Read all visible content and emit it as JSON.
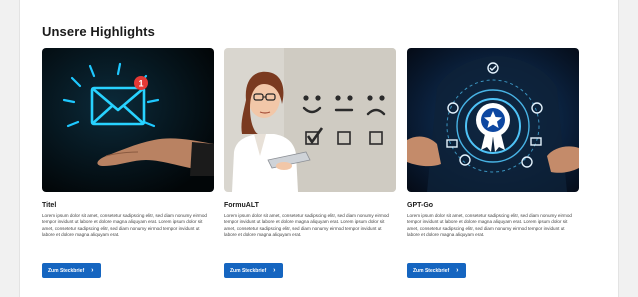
{
  "section": {
    "title": "Unsere Highlights"
  },
  "cards": [
    {
      "title": "Titel",
      "text": "Lorem ipsum dolor sit amet, consetetur sadipscing elitr, sed diam nonumy eirmod tempor invidunt ut labore et dolore magna aliquyam erat. Lorem ipsum dolor sit amet, consetetur sadipscing elitr, sed diam nonumy eirmod tempor invidunt ut labore et dolore magna aliquyam erat.",
      "button_label": "Zum Steckbrief",
      "image_icon": "email-notification-icon"
    },
    {
      "title": "FormuALT",
      "text": "Lorem ipsum dolor sit amet, consetetur sadipscing elitr, sed diam nonumy eirmod tempor invidunt ut labore et dolore magna aliquyam erat. Lorem ipsum dolor sit amet, consetetur sadipscing elitr, sed diam nonumy eirmod tempor invidunt ut labore et dolore magna aliquyam erat.",
      "button_label": "Zum Steckbrief",
      "image_icon": "feedback-rating-icon"
    },
    {
      "title": "GPT-Go",
      "text": "Lorem ipsum dolor sit amet, consetetur sadipscing elitr, sed diam nonumy eirmod tempor invidunt ut labore et dolore magna aliquyam erat. Lorem ipsum dolor sit amet, consetetur sadipscing elitr, sed diam nonumy eirmod tempor invidunt ut labore et dolore magna aliquyam erat.",
      "button_label": "Zum Steckbrief",
      "image_icon": "award-badge-icon"
    }
  ],
  "colors": {
    "accent": "#1565c0",
    "page_bg": "#f1f1f1",
    "panel_bg": "#ffffff"
  }
}
